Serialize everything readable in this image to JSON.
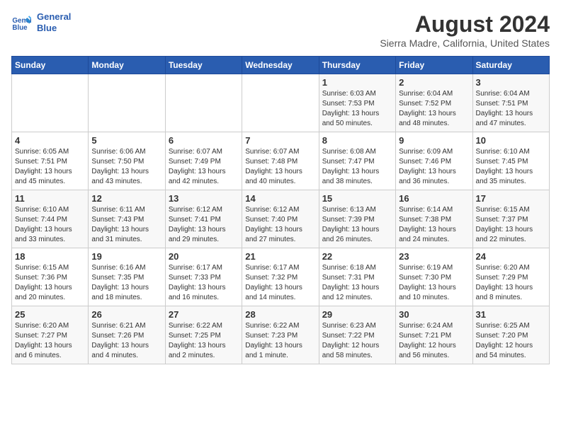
{
  "logo": {
    "line1": "General",
    "line2": "Blue"
  },
  "header": {
    "month_year": "August 2024",
    "location": "Sierra Madre, California, United States"
  },
  "days_of_week": [
    "Sunday",
    "Monday",
    "Tuesday",
    "Wednesday",
    "Thursday",
    "Friday",
    "Saturday"
  ],
  "weeks": [
    [
      {
        "day": "",
        "info": ""
      },
      {
        "day": "",
        "info": ""
      },
      {
        "day": "",
        "info": ""
      },
      {
        "day": "",
        "info": ""
      },
      {
        "day": "1",
        "info": "Sunrise: 6:03 AM\nSunset: 7:53 PM\nDaylight: 13 hours\nand 50 minutes."
      },
      {
        "day": "2",
        "info": "Sunrise: 6:04 AM\nSunset: 7:52 PM\nDaylight: 13 hours\nand 48 minutes."
      },
      {
        "day": "3",
        "info": "Sunrise: 6:04 AM\nSunset: 7:51 PM\nDaylight: 13 hours\nand 47 minutes."
      }
    ],
    [
      {
        "day": "4",
        "info": "Sunrise: 6:05 AM\nSunset: 7:51 PM\nDaylight: 13 hours\nand 45 minutes."
      },
      {
        "day": "5",
        "info": "Sunrise: 6:06 AM\nSunset: 7:50 PM\nDaylight: 13 hours\nand 43 minutes."
      },
      {
        "day": "6",
        "info": "Sunrise: 6:07 AM\nSunset: 7:49 PM\nDaylight: 13 hours\nand 42 minutes."
      },
      {
        "day": "7",
        "info": "Sunrise: 6:07 AM\nSunset: 7:48 PM\nDaylight: 13 hours\nand 40 minutes."
      },
      {
        "day": "8",
        "info": "Sunrise: 6:08 AM\nSunset: 7:47 PM\nDaylight: 13 hours\nand 38 minutes."
      },
      {
        "day": "9",
        "info": "Sunrise: 6:09 AM\nSunset: 7:46 PM\nDaylight: 13 hours\nand 36 minutes."
      },
      {
        "day": "10",
        "info": "Sunrise: 6:10 AM\nSunset: 7:45 PM\nDaylight: 13 hours\nand 35 minutes."
      }
    ],
    [
      {
        "day": "11",
        "info": "Sunrise: 6:10 AM\nSunset: 7:44 PM\nDaylight: 13 hours\nand 33 minutes."
      },
      {
        "day": "12",
        "info": "Sunrise: 6:11 AM\nSunset: 7:43 PM\nDaylight: 13 hours\nand 31 minutes."
      },
      {
        "day": "13",
        "info": "Sunrise: 6:12 AM\nSunset: 7:41 PM\nDaylight: 13 hours\nand 29 minutes."
      },
      {
        "day": "14",
        "info": "Sunrise: 6:12 AM\nSunset: 7:40 PM\nDaylight: 13 hours\nand 27 minutes."
      },
      {
        "day": "15",
        "info": "Sunrise: 6:13 AM\nSunset: 7:39 PM\nDaylight: 13 hours\nand 26 minutes."
      },
      {
        "day": "16",
        "info": "Sunrise: 6:14 AM\nSunset: 7:38 PM\nDaylight: 13 hours\nand 24 minutes."
      },
      {
        "day": "17",
        "info": "Sunrise: 6:15 AM\nSunset: 7:37 PM\nDaylight: 13 hours\nand 22 minutes."
      }
    ],
    [
      {
        "day": "18",
        "info": "Sunrise: 6:15 AM\nSunset: 7:36 PM\nDaylight: 13 hours\nand 20 minutes."
      },
      {
        "day": "19",
        "info": "Sunrise: 6:16 AM\nSunset: 7:35 PM\nDaylight: 13 hours\nand 18 minutes."
      },
      {
        "day": "20",
        "info": "Sunrise: 6:17 AM\nSunset: 7:33 PM\nDaylight: 13 hours\nand 16 minutes."
      },
      {
        "day": "21",
        "info": "Sunrise: 6:17 AM\nSunset: 7:32 PM\nDaylight: 13 hours\nand 14 minutes."
      },
      {
        "day": "22",
        "info": "Sunrise: 6:18 AM\nSunset: 7:31 PM\nDaylight: 13 hours\nand 12 minutes."
      },
      {
        "day": "23",
        "info": "Sunrise: 6:19 AM\nSunset: 7:30 PM\nDaylight: 13 hours\nand 10 minutes."
      },
      {
        "day": "24",
        "info": "Sunrise: 6:20 AM\nSunset: 7:29 PM\nDaylight: 13 hours\nand 8 minutes."
      }
    ],
    [
      {
        "day": "25",
        "info": "Sunrise: 6:20 AM\nSunset: 7:27 PM\nDaylight: 13 hours\nand 6 minutes."
      },
      {
        "day": "26",
        "info": "Sunrise: 6:21 AM\nSunset: 7:26 PM\nDaylight: 13 hours\nand 4 minutes."
      },
      {
        "day": "27",
        "info": "Sunrise: 6:22 AM\nSunset: 7:25 PM\nDaylight: 13 hours\nand 2 minutes."
      },
      {
        "day": "28",
        "info": "Sunrise: 6:22 AM\nSunset: 7:23 PM\nDaylight: 13 hours\nand 1 minute."
      },
      {
        "day": "29",
        "info": "Sunrise: 6:23 AM\nSunset: 7:22 PM\nDaylight: 12 hours\nand 58 minutes."
      },
      {
        "day": "30",
        "info": "Sunrise: 6:24 AM\nSunset: 7:21 PM\nDaylight: 12 hours\nand 56 minutes."
      },
      {
        "day": "31",
        "info": "Sunrise: 6:25 AM\nSunset: 7:20 PM\nDaylight: 12 hours\nand 54 minutes."
      }
    ]
  ]
}
